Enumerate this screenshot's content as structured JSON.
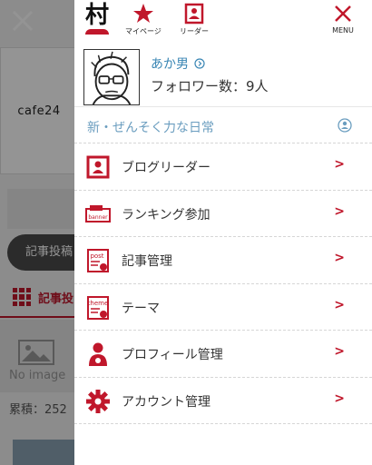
{
  "background": {
    "brand": "cafe24",
    "pill_text": "記事投稿",
    "tab_label": "記事投",
    "no_image": "No image",
    "total": "累積：252（"
  },
  "drawer": {
    "logo_text": "村",
    "top": {
      "mypage": "マイページ",
      "reader": "リーダー",
      "menu": "MENU"
    },
    "profile": {
      "name": "あか男",
      "follower": "フォロワー数：9人"
    },
    "blog_title": "新・ぜんそく力な日常",
    "menu_items": [
      {
        "label": "ブログリーダー",
        "icon": "reader-icon",
        "arrow": ">"
      },
      {
        "label": "ランキング参加",
        "icon": "banner-icon",
        "arrow": ">"
      },
      {
        "label": "記事管理",
        "icon": "post-icon",
        "arrow": ">"
      },
      {
        "label": "テーマ",
        "icon": "theme-icon",
        "arrow": ">"
      },
      {
        "label": "プロフィール管理",
        "icon": "profile-settings-icon",
        "arrow": ">"
      },
      {
        "label": "アカウント管理",
        "icon": "gear-icon",
        "arrow": ">"
      }
    ]
  },
  "colors": {
    "accent": "#c0172b",
    "link": "#3a86b4",
    "blog_title": "#6a9dbf"
  }
}
